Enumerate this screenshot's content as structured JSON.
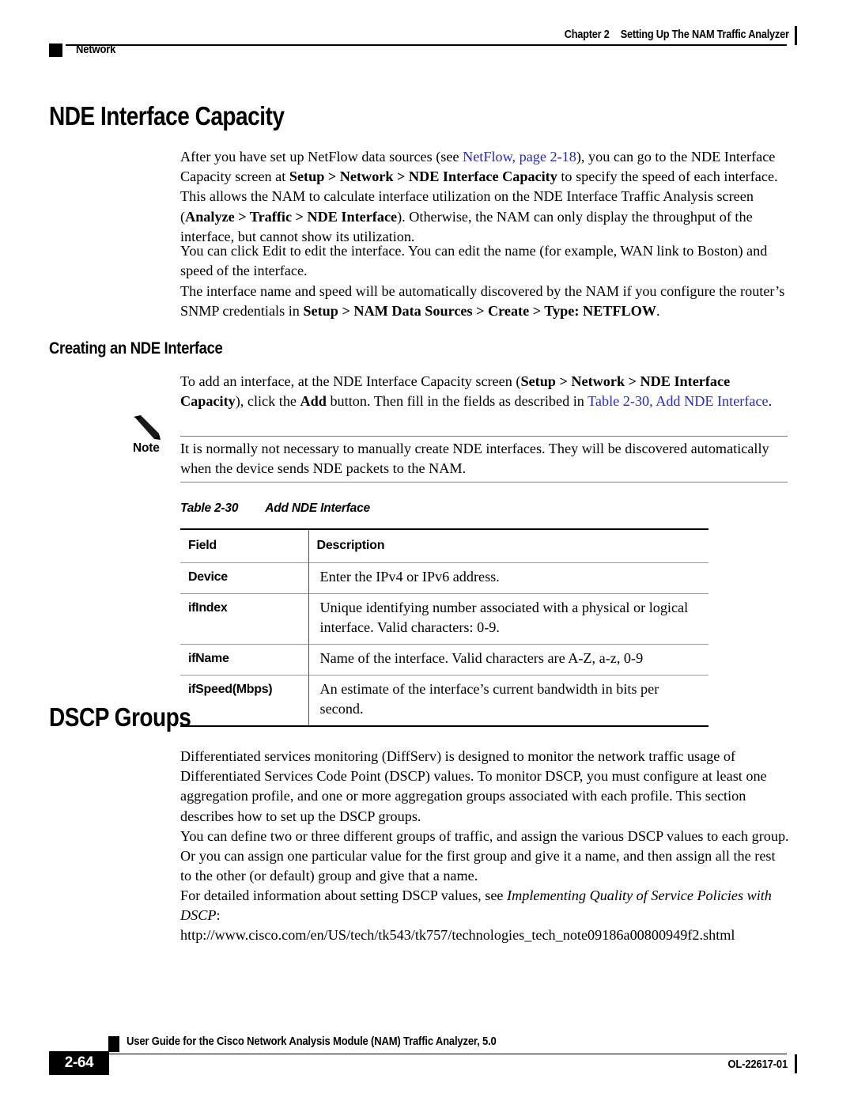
{
  "header": {
    "chapter_label": "Chapter 2",
    "chapter_title": "Setting Up The NAM Traffic Analyzer",
    "section_label": "Network"
  },
  "section1": {
    "heading": "NDE Interface Capacity",
    "p1": {
      "t1": "After you have set up NetFlow data sources (see ",
      "link1": "NetFlow, page 2-18",
      "t2": "), you can go to the NDE Interface Capacity screen at ",
      "b1": "Setup > Network > NDE Interface Capacity",
      "t3": " to specify the speed of each interface. This allows the NAM to calculate interface utilization on the NDE Interface Traffic Analysis screen (",
      "b2": "Analyze > Traffic > NDE Interface",
      "t4": "). Otherwise, the NAM can only display the throughput of the interface, but cannot show its utilization."
    },
    "p2": "You can click Edit to edit the interface. You can edit the name (for example, WAN link to Boston) and speed of the interface.",
    "p3": {
      "t1": "The interface name and speed will be automatically discovered by the NAM if you configure the router’s SNMP credentials in ",
      "b1": "Setup > NAM Data Sources > Create > Type: NETFLOW",
      "t2": "."
    }
  },
  "section2": {
    "heading": "Creating an NDE Interface",
    "p1": {
      "t1": "To add an interface, at the NDE Interface Capacity screen (",
      "b1": "Setup > Network > NDE Interface Capacity",
      "t2": "), click the ",
      "b2": "Add",
      "t3": " button. Then fill in the fields as described in ",
      "link1": "Table 2-30, Add NDE Interface",
      "t4": "."
    },
    "note": {
      "label": "Note",
      "icon": "pencil-icon",
      "text": "It is normally not necessary to manually create NDE interfaces. They will be discovered automatically when the device sends NDE packets to the NAM."
    },
    "table": {
      "caption_number": "Table 2-30",
      "caption_title": "Add NDE Interface",
      "columns": [
        "Field",
        "Description"
      ],
      "rows": [
        {
          "field": "Device",
          "description": "Enter the IPv4 or IPv6 address."
        },
        {
          "field": "ifIndex",
          "description": "Unique identifying number associated with a physical or logical interface. Valid characters: 0-9."
        },
        {
          "field": "ifName",
          "description": "Name of the interface. Valid characters are A-Z, a-z, 0-9"
        },
        {
          "field": "ifSpeed(Mbps)",
          "description": "An estimate of the interface’s current bandwidth in bits per second."
        }
      ]
    }
  },
  "section3": {
    "heading": "DSCP Groups",
    "p1": "Differentiated services monitoring (DiffServ) is designed to monitor the network traffic usage of Differentiated Services Code Point (DSCP) values. To monitor DSCP, you must configure at least one aggregation profile, and one or more aggregation groups associated with each profile. This section describes how to set up the DSCP groups.",
    "p2": "You can define two or three different groups of traffic, and assign the various DSCP values to each group. Or you can assign one particular value for the first group and give it a name, and then assign all the rest to the other (or default) group and give that a name.",
    "p3": {
      "t1": "For detailed information about setting DSCP values, see ",
      "i1": "Implementing Quality of Service Policies with DSCP",
      "t2": ":"
    },
    "url": "http://www.cisco.com/en/US/tech/tk543/tk757/technologies_tech_note09186a00800949f2.shtml"
  },
  "footer": {
    "guide_title": "User Guide for the Cisco Network Analysis Module (NAM) Traffic Analyzer, 5.0",
    "page_number": "2-64",
    "doc_id": "OL-22617-01"
  },
  "colors": {
    "link": "#2526cf",
    "rule": "#000000",
    "table_rule_light": "#9a9a9a"
  }
}
